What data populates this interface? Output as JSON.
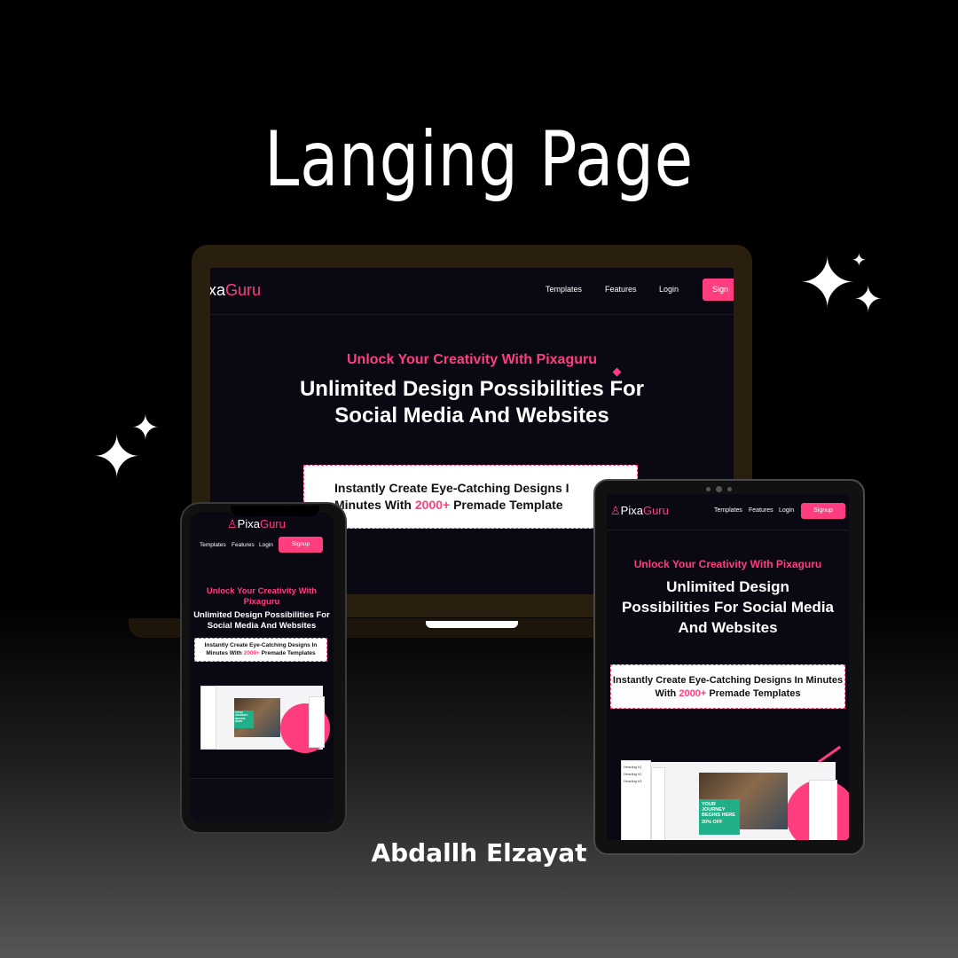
{
  "title": "Langing Page",
  "author": "Abdallh Elzayat",
  "brand": {
    "logo_prefix": "Pixa",
    "logo_suffix": "Guru",
    "logo_cut": "xa",
    "accent": "#ff3d7f"
  },
  "nav": {
    "templates": "Templates",
    "features": "Features",
    "login": "Login",
    "signup": "Signup",
    "signup_cut": "Sign"
  },
  "hero": {
    "kicker": "Unlock Your Creativity With Pixaguru",
    "headline": "Unlimited Design Possibilities For Social Media And Websites",
    "callout_pre": "Instantly Create Eye-Catching Designs In Minutes With",
    "callout_number": "2000+",
    "callout_post": "Premade Templates",
    "laptop_line1": "Instantly Create Eye-Catching Designs I",
    "laptop_line2_pre": "Minutes With",
    "laptop_line2_post": "Premade Template"
  },
  "editor_preview": {
    "banner": "YOUR JOURNEY BEGINS HERE",
    "discount": "20% OFF",
    "panel_items": [
      "Heading h1",
      "Heading h2",
      "Heading h3"
    ]
  },
  "icons": [
    "sparkle-icon",
    "logo-icon"
  ]
}
